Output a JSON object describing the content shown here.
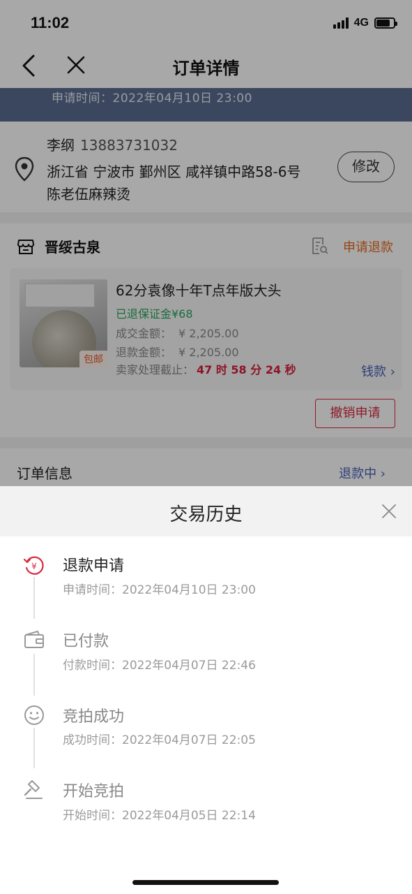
{
  "status_bar": {
    "time": "11:02",
    "network": "4G"
  },
  "nav": {
    "title": "订单详情"
  },
  "refund_banner": {
    "text": "申请时间：2022年04月10日 23:00"
  },
  "address": {
    "name": "李纲",
    "phone": "13883731032",
    "line1": "浙江省 宁波市 鄞州区 咸祥镇中路58-6号",
    "line2": "陈老伍麻辣烫",
    "edit_label": "修改"
  },
  "shop": {
    "name": "晋绥古泉",
    "refund_link": "申请退款",
    "item": {
      "badge": "包邮",
      "title": "62分袁像十年T点年版大头",
      "deposit": "已退保证金¥68",
      "deal_label": "成交金额：",
      "deal_value": "¥ 2,205.00",
      "refund_label": "退款金额：",
      "refund_value": "¥ 2,205.00",
      "deadline_label": "卖家处理截止：",
      "deadline_value": "47 时 58 分 24 秒",
      "refund_status_link": "钱款"
    },
    "cancel_button": "撤销申请"
  },
  "order_info": {
    "label": "订单信息",
    "status": "退款中"
  },
  "sheet": {
    "title": "交易历史",
    "events": [
      {
        "title": "退款申请",
        "time_label": "申请时间：",
        "time": "2022年04月10日 23:00",
        "icon": "refund-clock-icon",
        "active": true
      },
      {
        "title": "已付款",
        "time_label": "付款时间：",
        "time": "2022年04月07日 22:46",
        "icon": "wallet-icon",
        "active": false
      },
      {
        "title": "竞拍成功",
        "time_label": "成功时间：",
        "time": "2022年04月07日 22:05",
        "icon": "smile-icon",
        "active": false
      },
      {
        "title": "开始竞拍",
        "time_label": "开始时间：",
        "time": "2022年04月05日 22:14",
        "icon": "gavel-icon",
        "active": false
      }
    ]
  },
  "colors": {
    "accent_red": "#d8283f",
    "link_blue": "#4660b8",
    "orange": "#e46a1e",
    "green": "#2aa55a",
    "banner": "#5a6d8f"
  }
}
